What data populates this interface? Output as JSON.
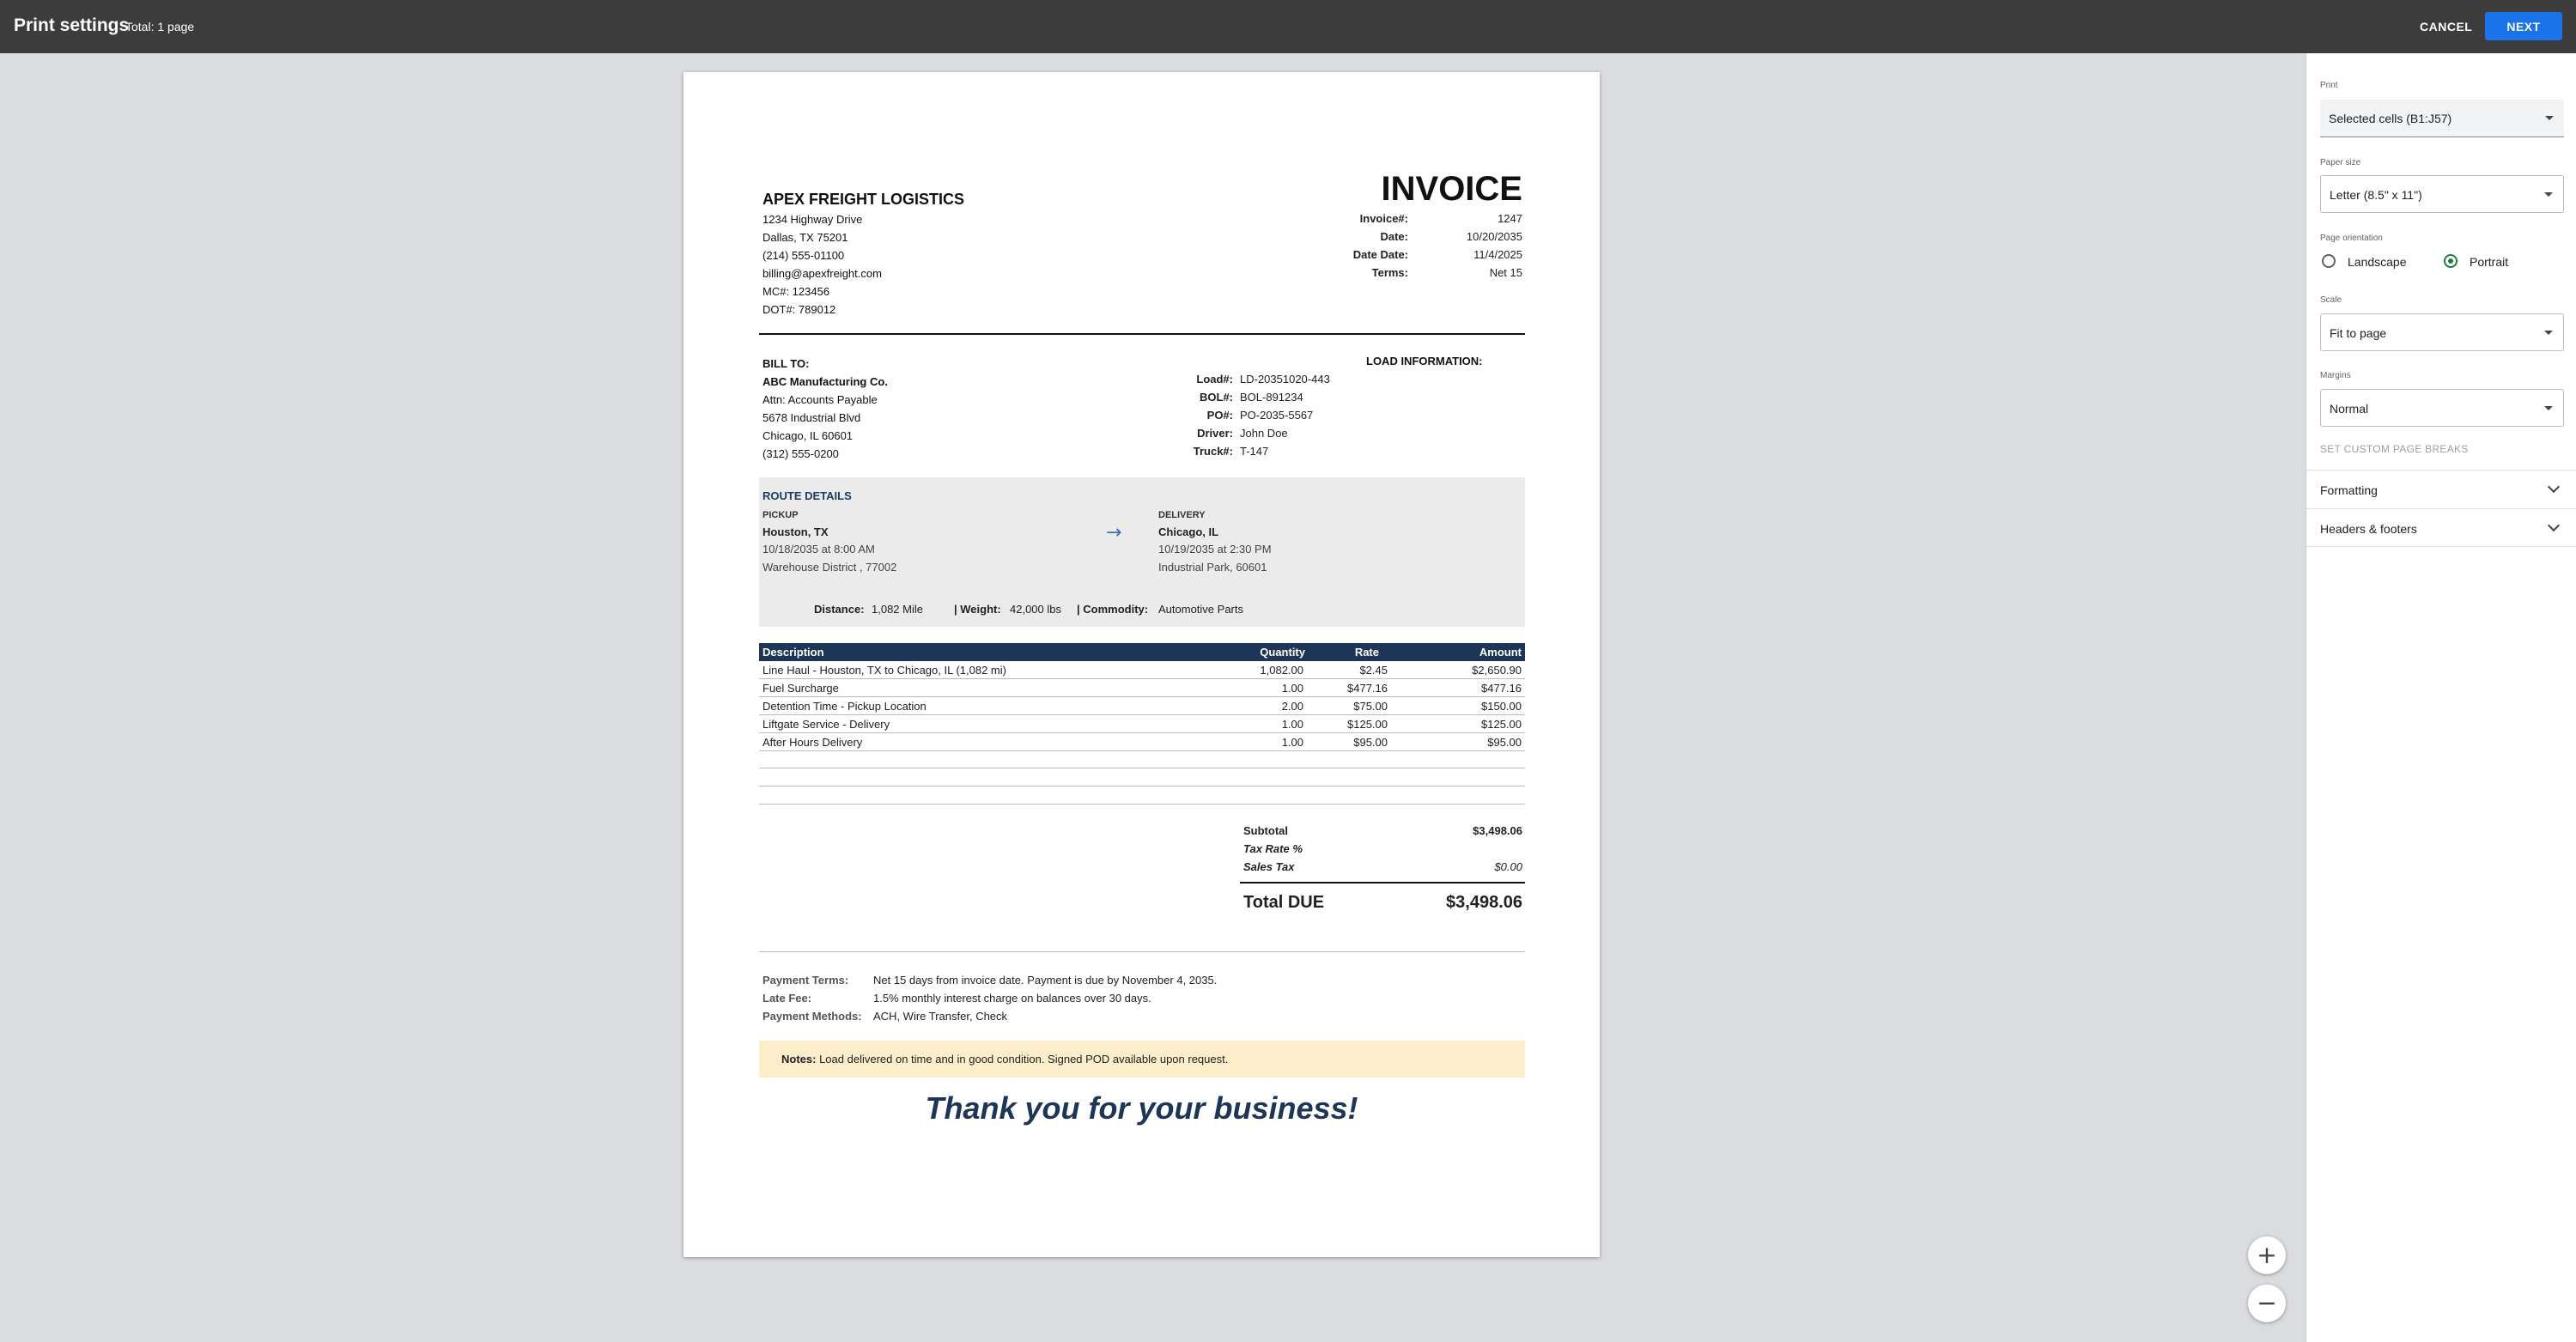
{
  "topbar": {
    "title": "Print settings",
    "total": "Total: 1 page",
    "cancel": "CANCEL",
    "next": "NEXT"
  },
  "invoice": {
    "company": "APEX FREIGHT LOGISTICS",
    "address_lines": [
      "1234 Highway Drive",
      "Dallas, TX 75201",
      "(214) 555-01100",
      "billing@apexfreight.com",
      "MC#: 123456",
      "DOT#: 789012"
    ],
    "title": "INVOICE",
    "meta": [
      {
        "label": "Invoice#:",
        "value": "1247"
      },
      {
        "label": "Date:",
        "value": "10/20/2035"
      },
      {
        "label": "Date Date:",
        "value": "11/4/2025"
      },
      {
        "label": "Terms:",
        "value": "Net 15"
      }
    ],
    "bill_to_title": "BILL TO:",
    "bill_to": [
      "ABC Manufacturing Co.",
      "Attn: Accounts Payable",
      "5678 Industrial Blvd",
      "Chicago, IL 60601",
      "(312) 555-0200"
    ],
    "load_info_title": "LOAD INFORMATION:",
    "load_info": [
      {
        "label": "Load#:",
        "value": "LD-20351020-443"
      },
      {
        "label": "BOL#:",
        "value": "BOL-891234"
      },
      {
        "label": "PO#:",
        "value": "PO-2035-5567"
      },
      {
        "label": "Driver:",
        "value": "John Doe"
      },
      {
        "label": "Truck#:",
        "value": "T-147"
      }
    ],
    "route": {
      "title": "ROUTE DETAILS",
      "pickup_label": "PICKUP",
      "pickup_city": "Houston, TX",
      "pickup_time": "10/18/2035 at 8:00 AM",
      "pickup_place": "Warehouse District , 77002",
      "arrow": "→",
      "delivery_label": "DELIVERY",
      "delivery_city": "Chicago, IL",
      "delivery_time": "10/19/2035 at 2:30 PM",
      "delivery_place": "Industrial Park, 60601",
      "distance_label": "Distance:",
      "distance": "1,082 Mile",
      "weight_label": "| Weight:",
      "weight": "42,000 lbs",
      "commodity_label": "| Commodity:",
      "commodity": "Automotive Parts"
    },
    "table": {
      "headers": [
        "Description",
        "Quantity",
        "Rate",
        "Amount"
      ],
      "rows": [
        [
          "Line Haul - Houston, TX to Chicago, IL (1,082 mi)",
          "1,082.00",
          "$2.45",
          "$2,650.90"
        ],
        [
          "Fuel Surcharge",
          "1.00",
          "$477.16",
          "$477.16"
        ],
        [
          "Detention Time - Pickup Location",
          "2.00",
          "$75.00",
          "$150.00"
        ],
        [
          "Liftgate Service - Delivery",
          "1.00",
          "$125.00",
          "$125.00"
        ],
        [
          "After Hours Delivery",
          "1.00",
          "$95.00",
          "$95.00"
        ]
      ]
    },
    "totals": {
      "subtotal_label": "Subtotal",
      "subtotal": "$3,498.06",
      "tax_rate_label": "Tax Rate %",
      "sales_tax_label": "Sales Tax",
      "sales_tax": "$0.00",
      "total_label": "Total DUE",
      "total": "$3,498.06"
    },
    "payment": {
      "terms_label": "Payment Terms:",
      "terms": "Net 15 days from invoice date. Payment is due by November 4, 2035.",
      "late_label": "Late Fee:",
      "late": "1.5% monthly interest charge on balances over 30 days.",
      "methods_label": "Payment Methods:",
      "methods": "ACH, Wire Transfer, Check"
    },
    "notes_label": "Notes:",
    "notes": "Load delivered on time and in good condition. Signed POD available upon request.",
    "thanks": "Thank you for your business!"
  },
  "zoom": {
    "in": "+",
    "out": "−"
  },
  "panel": {
    "print_label": "Print",
    "print_value": "Selected cells (B1:J57)",
    "paper_label": "Paper size",
    "paper_value": "Letter (8.5\" x 11\")",
    "orientation_label": "Page orientation",
    "landscape": "Landscape",
    "portrait": "Portrait",
    "scale_label": "Scale",
    "scale_value": "Fit to page",
    "margins_label": "Margins",
    "margins_value": "Normal",
    "custom_breaks": "SET CUSTOM PAGE BREAKS",
    "formatting": "Formatting",
    "headers_footers": "Headers & footers"
  },
  "colors": {
    "accent": "#1a73e8",
    "radio_selected": "#188038",
    "table_header": "#1d3557",
    "notes_bg": "#fdeecb"
  }
}
